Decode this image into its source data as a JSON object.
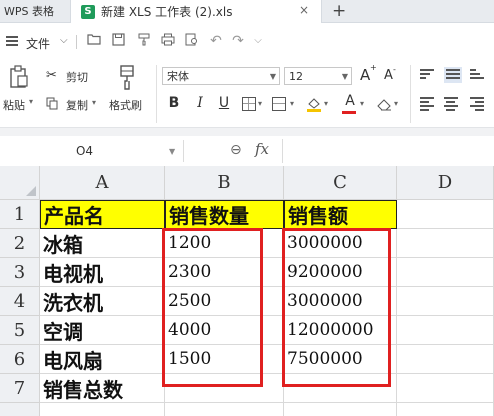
{
  "tabs": {
    "app_label": "WPS 表格",
    "file_icon": "S",
    "file_title": "新建 XLS 工作表 (2).xls",
    "close_glyph": "×",
    "add_glyph": "+"
  },
  "quickbar": {
    "file_menu": "文件",
    "icons": [
      "open-folder-icon",
      "save-icon",
      "format-painter-icon",
      "print-icon",
      "print-preview-icon",
      "undo-icon",
      "redo-icon",
      "more-icon"
    ]
  },
  "ribbon": {
    "paste_label": "粘贴",
    "cut_label": "剪切",
    "copy_label": "复制",
    "format_painter_label": "格式刷",
    "font_name": "宋体",
    "font_size": "12",
    "bold": "B",
    "italic": "I",
    "underline": "U",
    "grow_font": "A",
    "shrink_font": "A",
    "font_color_glyph": "A",
    "font_color": "#e02020"
  },
  "formula_bar": {
    "name_box": "O4",
    "fx": "fx",
    "formula_value": ""
  },
  "grid": {
    "columns": [
      "A",
      "B",
      "C",
      "D"
    ],
    "rows": [
      "1",
      "2",
      "3",
      "4",
      "5",
      "6",
      "7"
    ],
    "header": [
      "产品名",
      "销售数量",
      "销售额"
    ],
    "header_fill": "#ffff00",
    "products": [
      "冰箱",
      "电视机",
      "洗衣机",
      "空调",
      "电风扇",
      "销售总数"
    ],
    "quantities": [
      "1200",
      "2300",
      "2500",
      "4000",
      "1500"
    ],
    "sales": [
      "3000000",
      "9200000",
      "3000000",
      "12000000",
      "7500000"
    ],
    "highlight_color": "#e02020"
  }
}
